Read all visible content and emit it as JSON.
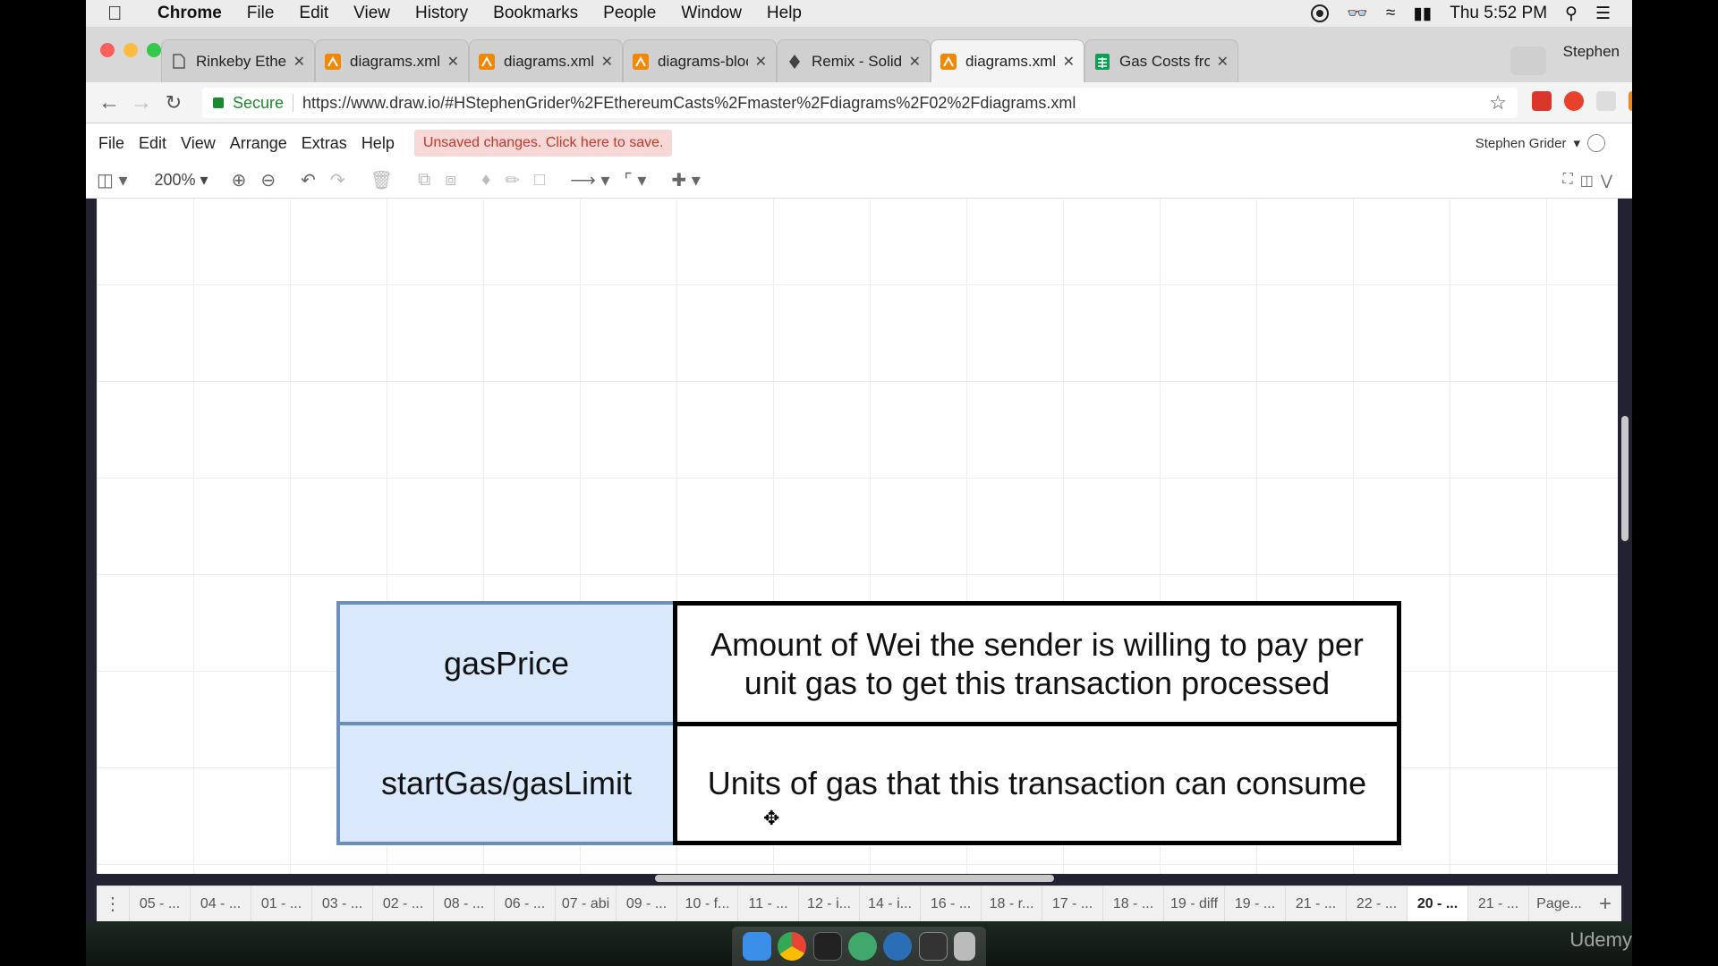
{
  "mac_menu": {
    "apple_icon": "apple-icon",
    "app": "Chrome",
    "items": [
      "File",
      "Edit",
      "View",
      "History",
      "Bookmarks",
      "People",
      "Window",
      "Help"
    ],
    "clock": "Thu 5:52 PM"
  },
  "browser": {
    "tabs": [
      {
        "title": "Rinkeby Ether Fau",
        "icon": "document-icon"
      },
      {
        "title": "diagrams.xml - dr",
        "icon": "drawio-icon"
      },
      {
        "title": "diagrams.xml - dr",
        "icon": "drawio-icon"
      },
      {
        "title": "diagrams-blockch",
        "icon": "drawio-icon"
      },
      {
        "title": "Remix - Solidity ID",
        "icon": "remix-icon"
      },
      {
        "title": "diagrams.xml - dr",
        "icon": "drawio-icon"
      },
      {
        "title": "Gas Costs from Yo",
        "icon": "sheets-icon"
      }
    ],
    "active_tab": 5,
    "profile": "Stephen",
    "secure_label": "Secure",
    "url": "https://www.draw.io/#HStephenGrider%2FEthereumCasts%2Fmaster%2Fdiagrams%2F02%2Fdiagrams.xml"
  },
  "drawio": {
    "menu": [
      "File",
      "Edit",
      "View",
      "Arrange",
      "Extras",
      "Help"
    ],
    "unsaved": "Unsaved changes. Click here to save.",
    "user": "Stephen Grider",
    "zoom": "200%"
  },
  "table": {
    "rows": [
      {
        "key": "gasPrice",
        "value": "Amount of Wei the sender is willing to pay per unit gas to get this transaction processed"
      },
      {
        "key": "startGas/gasLimit",
        "value": "Units of gas that this transaction can consume"
      }
    ],
    "key_fill": "#dae8fc",
    "key_stroke": "#6c8ebf"
  },
  "pages": [
    "05 - ...",
    "04 - ...",
    "01 - ...",
    "03 - ...",
    "02 - ...",
    "08 - ...",
    "06 - ...",
    "07 - abi",
    "09 - ...",
    "10 - f...",
    "11 - ...",
    "12 - i...",
    "14 - i...",
    "16 - ...",
    "18 - r...",
    "17 - ...",
    "18 - ...",
    "19 - diff",
    "19 - ...",
    "21 - ...",
    "22 - ...",
    "20 - ...",
    "21 - ...",
    "Page..."
  ],
  "active_page": 21,
  "watermark": "Udemy"
}
